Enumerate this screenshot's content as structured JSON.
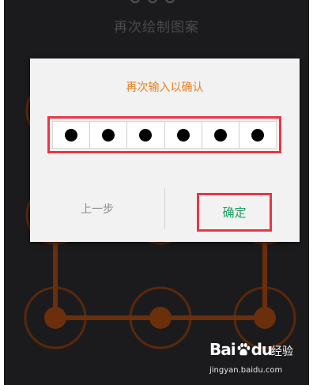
{
  "background": {
    "title": "再次绘制图案"
  },
  "dialog": {
    "title": "再次输入以确认",
    "code_dots": [
      "dot",
      "dot",
      "dot",
      "dot",
      "dot",
      "dot"
    ],
    "prev_label": "上一步",
    "confirm_label": "确定"
  },
  "watermark": {
    "logo_text": "Bai",
    "logo_text_2": "du",
    "jingyan": "经验",
    "url": "jingyan.baidu.com"
  },
  "colors": {
    "accent": "#e68022",
    "highlight": "#ea3545",
    "confirm": "#1aa063",
    "pattern": "#6b2f0b"
  },
  "icons": [
    "paw-icon"
  ]
}
